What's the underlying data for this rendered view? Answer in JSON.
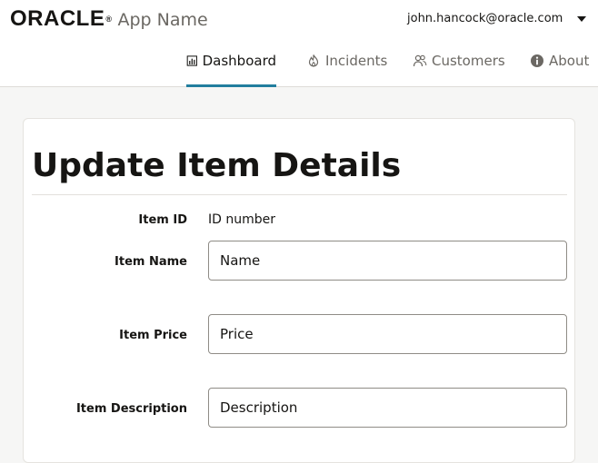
{
  "header": {
    "logo_text": "ORACLE",
    "logo_reg": "®",
    "app_name": "App Name",
    "user_email": "john.hancock@oracle.com"
  },
  "nav": {
    "tabs": [
      {
        "label": "Dashboard",
        "icon": "bar-chart-icon",
        "active": true
      },
      {
        "label": "Incidents",
        "icon": "fire-icon",
        "active": false
      },
      {
        "label": "Customers",
        "icon": "people-icon",
        "active": false
      },
      {
        "label": "About",
        "icon": "info-icon",
        "active": false
      }
    ]
  },
  "form": {
    "title": "Update Item Details",
    "id_label": "Item ID",
    "id_value": "ID number",
    "name_label": "Item Name",
    "name_placeholder": "Name",
    "price_label": "Item Price",
    "price_placeholder": "Price",
    "description_label": "Item Description",
    "description_placeholder": "Description"
  },
  "colors": {
    "accent": "#227e9e",
    "text": "#161513",
    "muted": "#6b6863"
  }
}
